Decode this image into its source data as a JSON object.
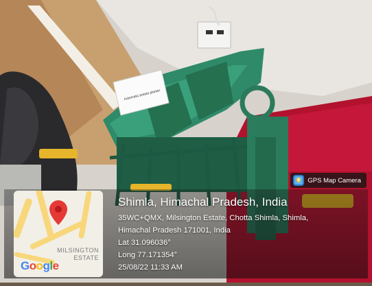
{
  "badge": {
    "label": "GPS Map Camera",
    "icon": "gps-map-camera-icon"
  },
  "location": {
    "city": "Shimla, Himachal Pradesh, India",
    "address_line1": "35WC+QMX, Milsington Estate, Chotta Shimla, Shimla,",
    "address_line2": "Himachal Pradesh 171001, India",
    "lat": "Lat 31.096036°",
    "long": "Long 77.171354°",
    "datetime": "25/08/22 11:33 AM"
  },
  "map": {
    "area_label_1": "MILSINGTON",
    "area_label_2": "ESTATE",
    "logo_letters": [
      "G",
      "o",
      "o",
      "g",
      "l",
      "e"
    ],
    "logo_colors": [
      "#4285F4",
      "#EA4335",
      "#FBBC05",
      "#4285F4",
      "#34A853",
      "#EA4335"
    ],
    "pin_color": "#e53935"
  },
  "sign_text": "Automatic potato planter"
}
